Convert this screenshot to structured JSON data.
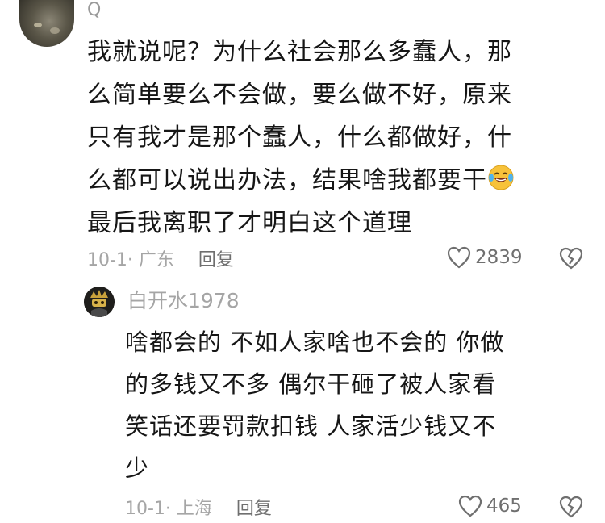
{
  "comment": {
    "username": "Q",
    "text": "我就说呢？为什么社会那么多蠢人，那\n么简单要么不会做，要么做不好，原来\n只有我才是那个蠢人，什么都做好，什\n么都可以说出办法，结果啥我都要干",
    "text_after_emoji": "\n最后我离职了才明白这个道理",
    "emoji": "laughing-crying-emoji",
    "date_location": "10-1· 广东",
    "reply_label": "回复",
    "likes": "2839"
  },
  "reply": {
    "username": "白开水1978",
    "text": "啥都会的 不如人家啥也不会的 你做\n的多钱又不多 偶尔干砸了被人家看\n笑话还要罚款扣钱 人家活少钱又不\n少",
    "date_location": "10-1· 上海",
    "reply_label": "回复",
    "likes": "465"
  },
  "icons": {
    "like": "heart-outline-icon",
    "dislike": "broken-heart-outline-icon"
  },
  "colors": {
    "text": "#161616",
    "meta": "#a5a5a5",
    "action": "#6f6f6f",
    "emoji_face": "#f7c23a"
  }
}
